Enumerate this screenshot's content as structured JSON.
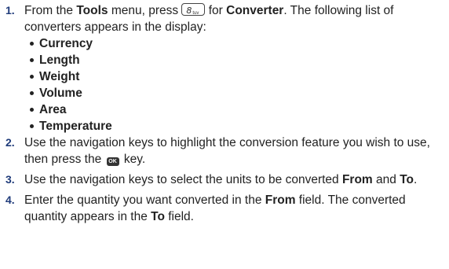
{
  "steps": [
    {
      "number": "1.",
      "t1": "From the ",
      "b1": "Tools",
      "t2": " menu, press ",
      "key_digit": "8",
      "key_letters": "tuv",
      "t3": " for ",
      "b2": "Converter",
      "t4": ". The following list of converters appears in the display:",
      "bullets": [
        "Currency",
        "Length",
        "Weight",
        "Volume",
        "Area",
        "Temperature"
      ]
    },
    {
      "number": "2.",
      "t1": "Use the navigation keys to highlight the conversion feature you wish to use, then press the ",
      "ok_key": "OK",
      "t2": " key."
    },
    {
      "number": "3.",
      "t1": "Use the navigation keys to select the units to be converted ",
      "b1": "From",
      "t2": " and ",
      "b2": "To",
      "t3": "."
    },
    {
      "number": "4.",
      "t1": "Enter the quantity you want converted in the ",
      "b1": "From",
      "t2": " field. The converted quantity appears in the ",
      "b2": "To",
      "t3": " field."
    }
  ]
}
